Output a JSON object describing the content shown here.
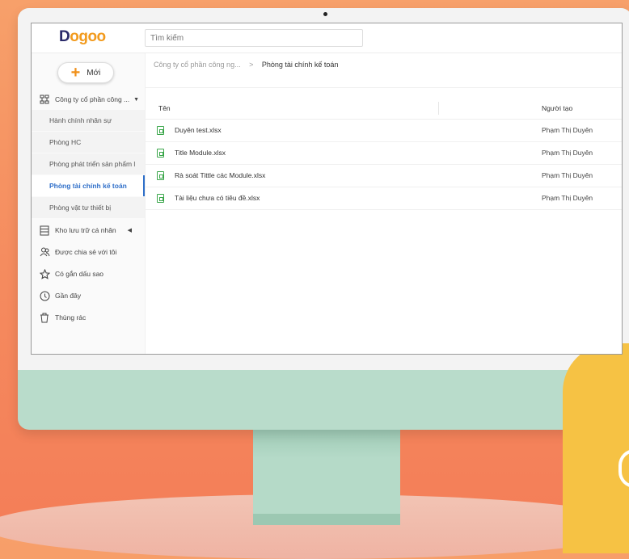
{
  "app": {
    "logo_text_d": "D",
    "logo_text_rest": "ogoo"
  },
  "search": {
    "placeholder": "Tìm kiếm"
  },
  "sidebar": {
    "new_button_label": "Mới",
    "company_label": "Công ty cổ phần công ...",
    "departments": [
      {
        "label": "Hành chính nhân sự"
      },
      {
        "label": "Phòng HC"
      },
      {
        "label": "Phòng phát triển sản phẩm l"
      },
      {
        "label": "Phòng tài chính kế toán"
      },
      {
        "label": "Phòng vật tư thiết bị"
      }
    ],
    "items": [
      {
        "label": "Kho lưu trữ cá nhân",
        "icon": "storage-icon"
      },
      {
        "label": "Được chia sẻ với tôi",
        "icon": "shared-users-icon"
      },
      {
        "label": "Có gắn dấu sao",
        "icon": "star-icon"
      },
      {
        "label": "Gần đây",
        "icon": "clock-icon"
      },
      {
        "label": "Thùng rác",
        "icon": "trash-icon"
      }
    ]
  },
  "breadcrumb": {
    "parent": "Công ty cổ phần công ng...",
    "separator": ">",
    "current": "Phòng tài chính kế toán"
  },
  "table": {
    "columns": {
      "name": "Tên",
      "owner": "Người tạo"
    },
    "rows": [
      {
        "name": "Duyên test.xlsx",
        "owner": "Phạm Thị Duyên"
      },
      {
        "name": "Title Module.xlsx",
        "owner": "Phạm Thị Duyên"
      },
      {
        "name": "Rà soát Tittle các Module.xlsx",
        "owner": "Phạm Thị Duyên"
      },
      {
        "name": "Tài liệu chưa có tiêu đề.xlsx",
        "owner": "Phạm Thị Duyên"
      }
    ]
  },
  "colors": {
    "accent": "#2f6fc9",
    "brand_orange": "#f29a1c",
    "brand_navy": "#2a2a6a",
    "file_green": "#3aa64a"
  }
}
